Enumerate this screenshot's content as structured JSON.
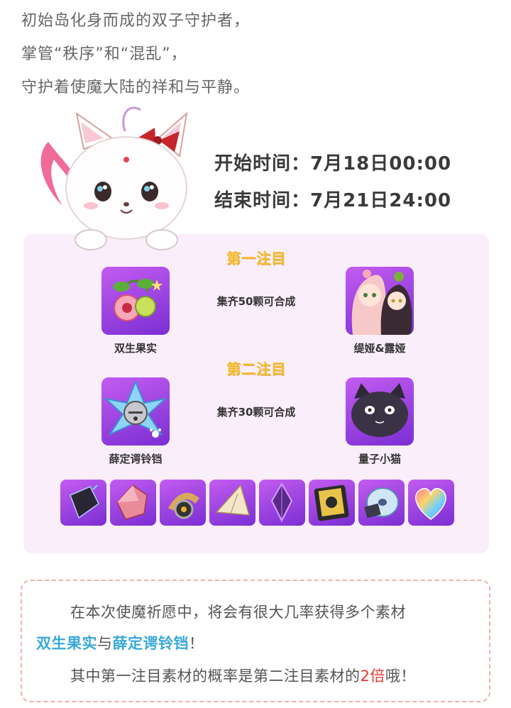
{
  "intro": {
    "line1": "初始岛化身而成的双子守护者，",
    "line2": "掌管“秩序”和“混乱”，",
    "line3": "守护着使魔大陆的祥和与平静。"
  },
  "times": {
    "start": "开始时间：7月18日00:00",
    "end": "结束时间：7月21日24:00"
  },
  "section1": {
    "title": "第一注目",
    "collect": "集齐50颗可合成",
    "material_label": "双生果实",
    "reward_label": "缇娅&露娅"
  },
  "section2": {
    "title": "第二注目",
    "collect": "集齐30颗可合成",
    "material_label": "薛定谔铃铛",
    "reward_label": "量子小猫"
  },
  "materials": [
    "black-crystal-icon",
    "red-gem-icon",
    "gear-cog-icon",
    "crystal-shard-icon",
    "purple-crystal-icon",
    "card-deck-icon",
    "disc-icon",
    "rainbow-heart-icon"
  ],
  "note": {
    "line1": "在本次使魔祈愿中，将会有很大几率获得多个素材",
    "item_a": "双生果实",
    "connector": "与",
    "item_b": "薛定谔铃铛",
    "end1": "！",
    "line3_pre": "其中第一注目素材的概率是第二注目素材的",
    "line3_hl": "2倍",
    "line3_post": "哦！"
  },
  "colors": {
    "accent_gold": "#f3b92a",
    "highlight_blue": "#3aa9d9",
    "highlight_red": "#e8372f",
    "panel_bg": "#fbeefb"
  }
}
